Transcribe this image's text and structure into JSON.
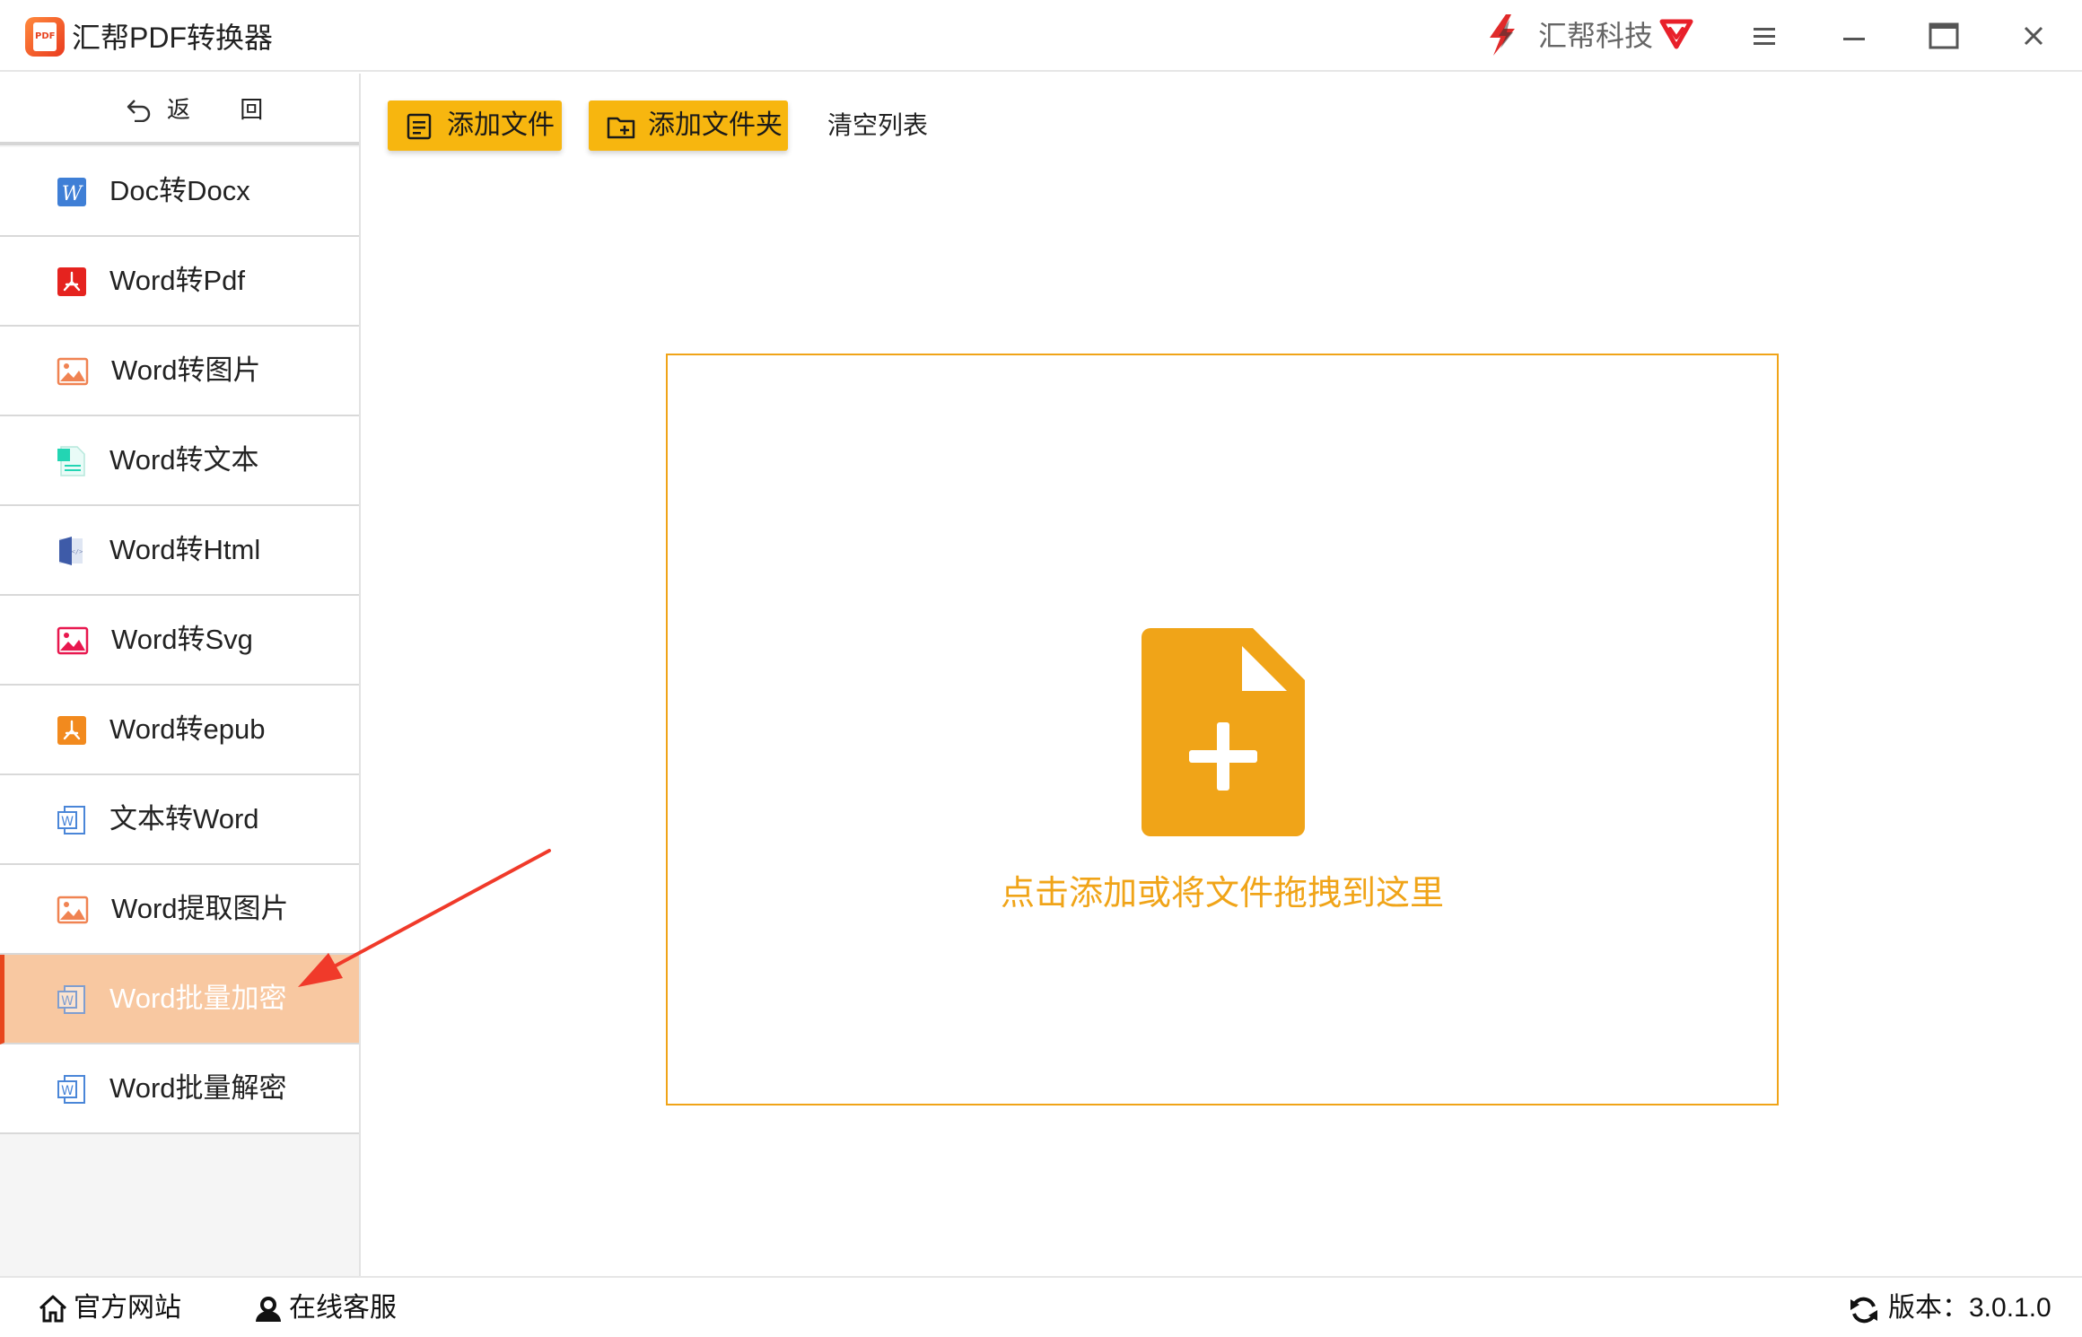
{
  "app": {
    "title": "汇帮PDF转换器",
    "logo_text": "PDF",
    "brand": "汇帮科技"
  },
  "window_controls": [
    "menu",
    "minimize",
    "maximize",
    "close"
  ],
  "sidebar": {
    "back_label": "返 回",
    "items": [
      {
        "label": "Doc转Docx",
        "icon": "word-w-icon",
        "active": false
      },
      {
        "label": "Word转Pdf",
        "icon": "pdf-icon",
        "active": false
      },
      {
        "label": "Word转图片",
        "icon": "image-icon",
        "active": false
      },
      {
        "label": "Word转文本",
        "icon": "text-file-icon",
        "active": false
      },
      {
        "label": "Word转Html",
        "icon": "html-book-icon",
        "active": false
      },
      {
        "label": "Word转Svg",
        "icon": "svg-image-icon",
        "active": false
      },
      {
        "label": "Word转epub",
        "icon": "epub-icon",
        "active": false
      },
      {
        "label": "文本转Word",
        "icon": "word-doc-icon",
        "active": false
      },
      {
        "label": "Word提取图片",
        "icon": "image-icon",
        "active": false
      },
      {
        "label": "Word批量加密",
        "icon": "word-doc-icon",
        "active": true
      },
      {
        "label": "Word批量解密",
        "icon": "word-doc-icon",
        "active": false
      }
    ]
  },
  "toolbar": {
    "add_file_label": "添加文件",
    "add_folder_label": "添加文件夹",
    "clear_label": "清空列表"
  },
  "dropzone": {
    "text": "点击添加或将文件拖拽到这里"
  },
  "footer": {
    "official_site": "官方网站",
    "support": "在线客服",
    "version": "版本：3.0.1.0"
  },
  "colors": {
    "accent_yellow": "#f7b60f",
    "drop_orange": "#f0a418",
    "active_item_bg": "#f8c8a1",
    "active_item_border": "#e8471d",
    "annotation_arrow": "#f03a2a"
  }
}
